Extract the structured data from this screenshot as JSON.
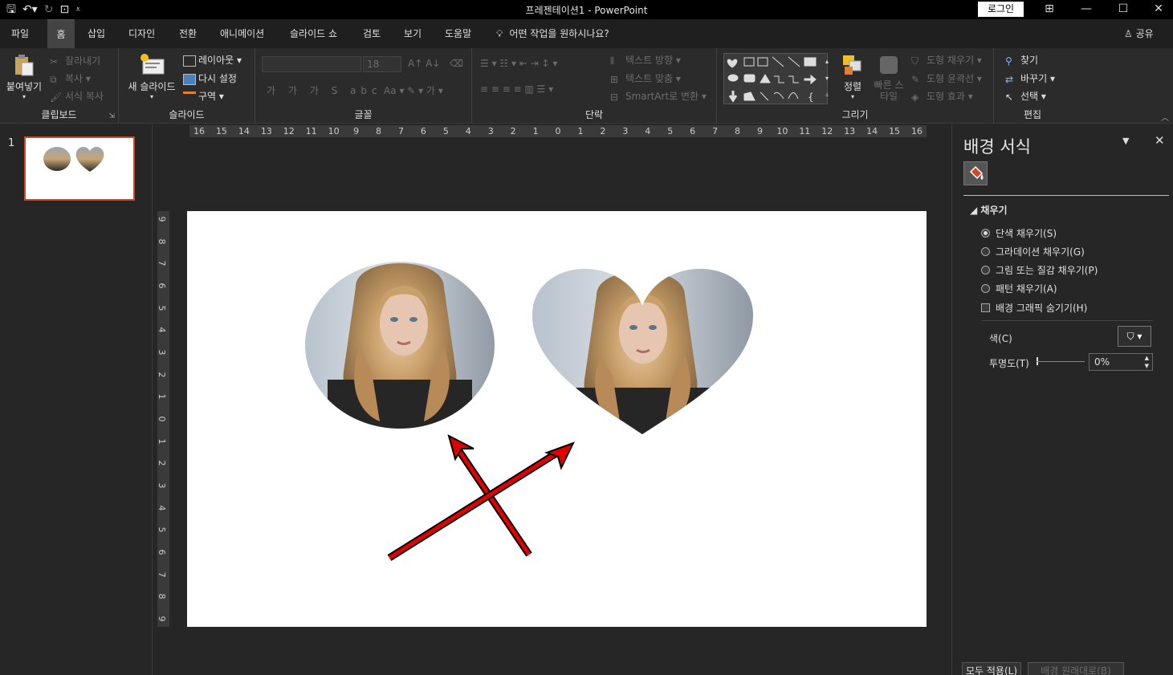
{
  "titlebar": {
    "doc_title": "프레젠테이션1 - PowerPoint",
    "login": "로그인"
  },
  "tabs": {
    "file": "파일",
    "home": "홈",
    "insert": "삽입",
    "design": "디자인",
    "transitions": "전환",
    "animations": "애니메이션",
    "slideshow": "슬라이드 쇼",
    "review": "검토",
    "view": "보기",
    "help": "도움말",
    "tellme": "어떤 작업을 원하시나요?",
    "share": "공유"
  },
  "ribbon": {
    "clipboard": {
      "label": "클립보드",
      "paste": "붙여넣기",
      "cut": "잘라내기",
      "copy": "복사",
      "format_painter": "서식 복사"
    },
    "slides": {
      "label": "슬라이드",
      "new_slide": "새 슬라이드",
      "layout": "레이아웃",
      "reset": "다시 설정",
      "section": "구역"
    },
    "font": {
      "label": "글꼴",
      "size": "18"
    },
    "paragraph": {
      "label": "단락",
      "text_direction": "텍스트 방향",
      "align_text": "텍스트 맞춤",
      "smartart": "SmartArt로 변환"
    },
    "drawing": {
      "label": "그리기",
      "arrange": "정렬",
      "quick_styles": "빠른 스타일",
      "shape_fill": "도형 채우기",
      "shape_outline": "도형 윤곽선",
      "shape_effects": "도형 효과"
    },
    "editing": {
      "label": "편집",
      "find": "찾기",
      "replace": "바꾸기",
      "select": "선택"
    }
  },
  "thumbs": {
    "slide_number": "1"
  },
  "rulers": {
    "h_ticks": [
      "16",
      "15",
      "14",
      "13",
      "12",
      "11",
      "10",
      "9",
      "8",
      "7",
      "6",
      "5",
      "4",
      "3",
      "2",
      "1",
      "0",
      "1",
      "2",
      "3",
      "4",
      "5",
      "6",
      "7",
      "8",
      "9",
      "10",
      "11",
      "12",
      "13",
      "14",
      "15",
      "16"
    ],
    "v_ticks": [
      "9",
      "8",
      "7",
      "6",
      "5",
      "4",
      "3",
      "2",
      "1",
      "0",
      "1",
      "2",
      "3",
      "4",
      "5",
      "6",
      "7",
      "8",
      "9"
    ]
  },
  "pane": {
    "title": "배경 서식",
    "section_fill": "채우기",
    "options": [
      {
        "label": "단색 채우기(S)",
        "selected": true
      },
      {
        "label": "그라데이션 채우기(G)",
        "selected": false
      },
      {
        "label": "그림 또는 질감 채우기(P)",
        "selected": false
      },
      {
        "label": "패턴 채우기(A)",
        "selected": false
      }
    ],
    "hide_graphics": "배경 그래픽 숨기기(H)",
    "color_label": "색(C)",
    "transparency_label": "투명도(T)",
    "transparency_value": "0%",
    "apply_all": "모두 적용(L)",
    "reset_bg": "배경 원래대로(B)"
  },
  "colors": {
    "accent": "#d24726",
    "arrow_fill": "#e00000"
  }
}
